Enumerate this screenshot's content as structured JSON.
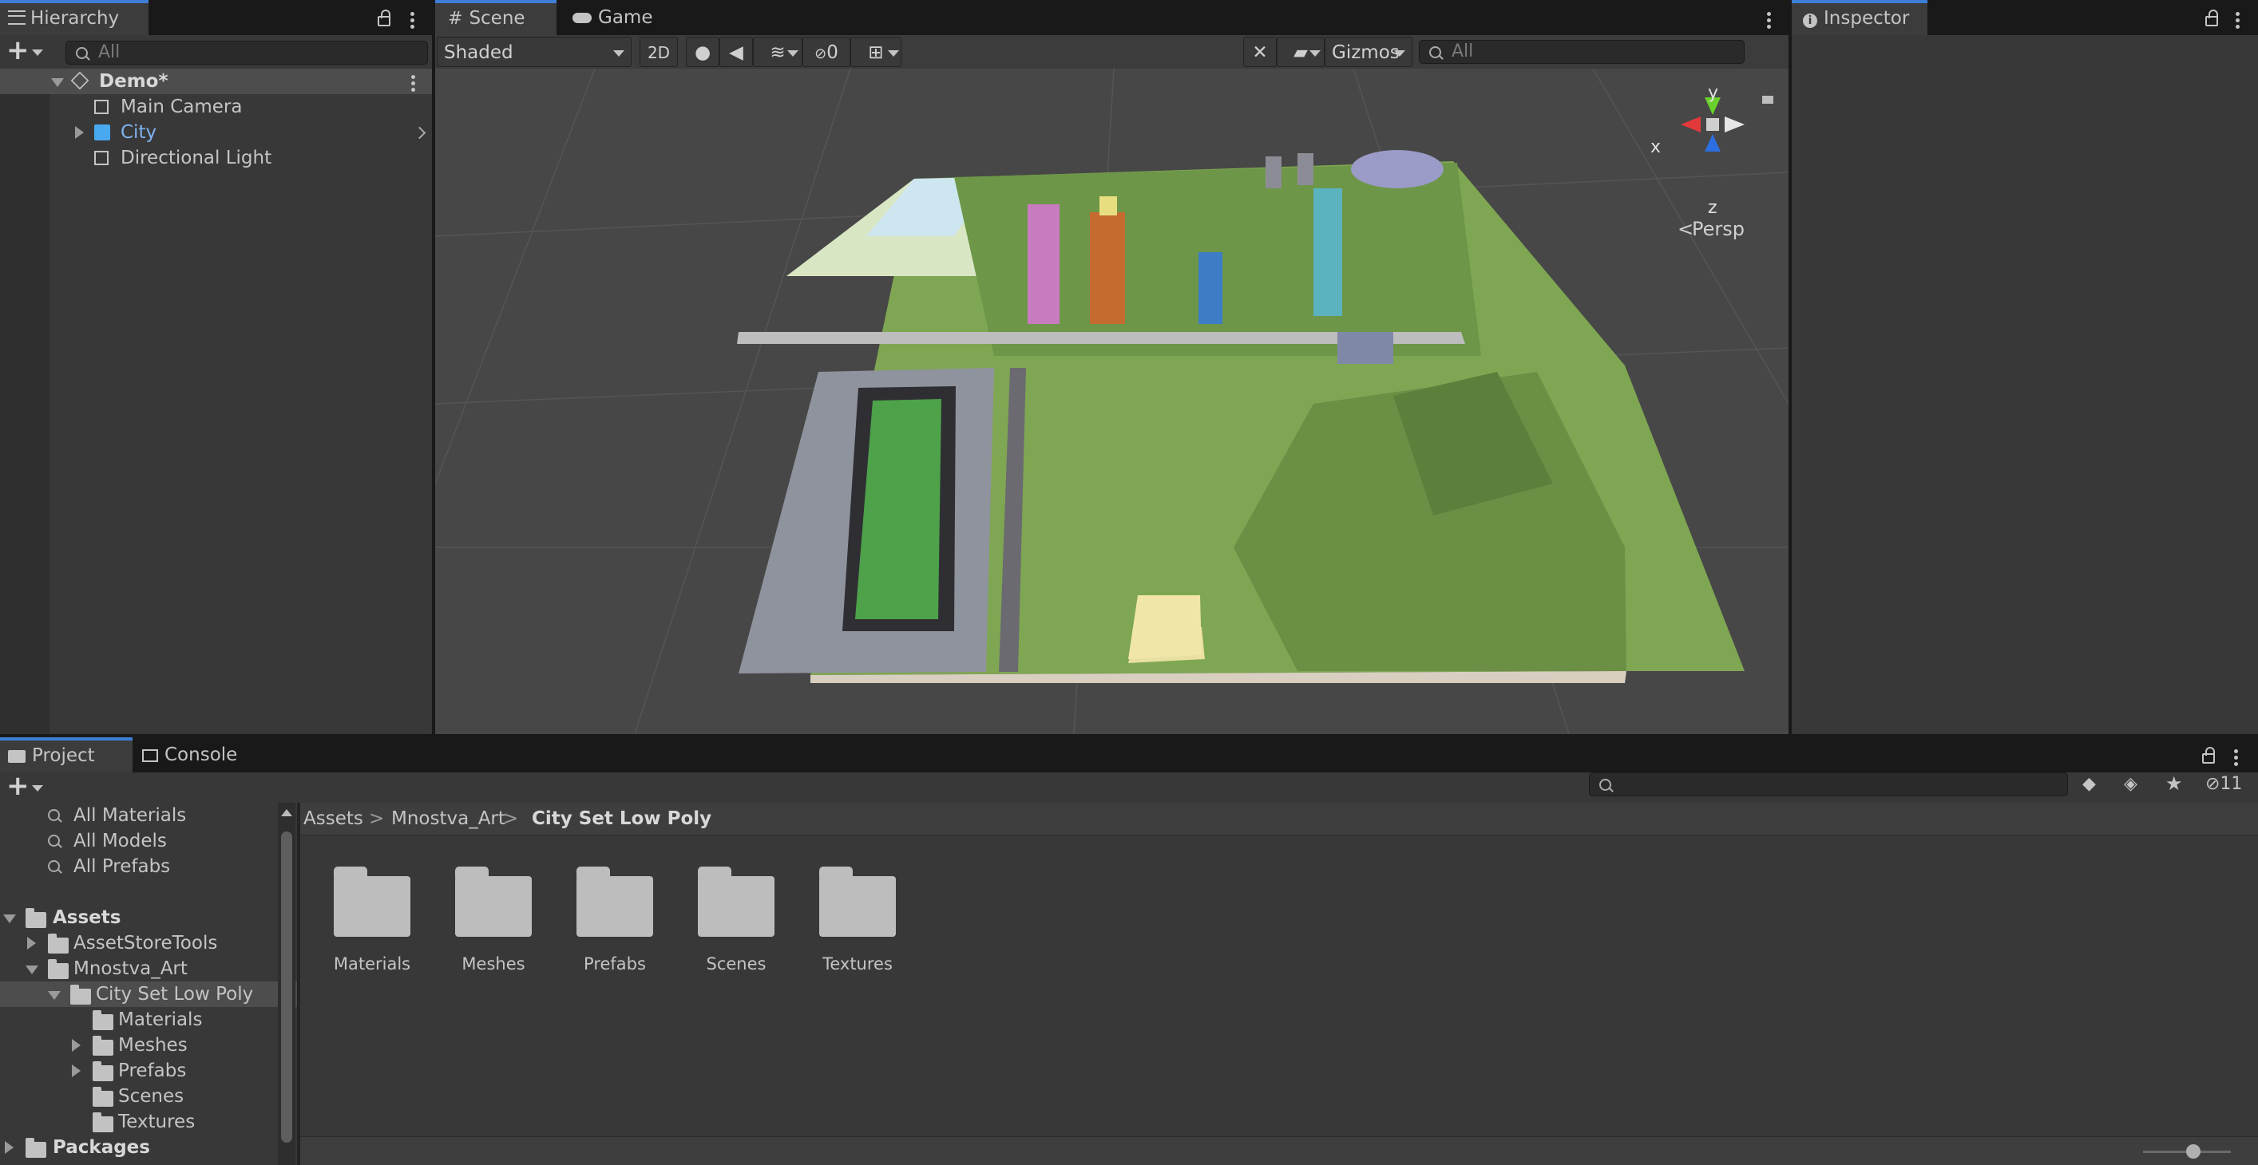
{
  "hierarchy": {
    "tab_label": "Hierarchy",
    "search_placeholder": "All",
    "scene_name": "Demo*",
    "items": [
      {
        "label": "Main Camera"
      },
      {
        "label": "City"
      },
      {
        "label": "Directional Light"
      }
    ]
  },
  "scene_view": {
    "tabs": [
      {
        "label": "Scene"
      },
      {
        "label": "Game"
      }
    ],
    "shading_mode": "Shaded",
    "toggle_2d": "2D",
    "hidden_count": "0",
    "gizmos_label": "Gizmos",
    "search_placeholder": "All",
    "axis_labels": {
      "y": "y",
      "x": "x",
      "z": "z"
    },
    "projection_label": "Persp"
  },
  "inspector": {
    "tab_label": "Inspector"
  },
  "project": {
    "tabs": [
      {
        "label": "Project"
      },
      {
        "label": "Console"
      }
    ],
    "hidden_count": "11",
    "favorites": [
      {
        "label": "All Materials"
      },
      {
        "label": "All Models"
      },
      {
        "label": "All Prefabs"
      }
    ],
    "tree": {
      "assets": "Assets",
      "asset_store_tools": "AssetStoreTools",
      "mnostva_art": "Mnostva_Art",
      "city_set": "City Set Low Poly",
      "materials": "Materials",
      "meshes": "Meshes",
      "prefabs": "Prefabs",
      "scenes": "Scenes",
      "textures": "Textures",
      "packages": "Packages"
    },
    "breadcrumb": [
      "Assets",
      "Mnostva_Art",
      "City Set Low Poly"
    ],
    "folders": [
      {
        "label": "Materials"
      },
      {
        "label": "Meshes"
      },
      {
        "label": "Prefabs"
      },
      {
        "label": "Scenes"
      },
      {
        "label": "Textures"
      }
    ]
  },
  "colors": {
    "accent": "#3d7fd8",
    "selected_row": "#4d4d4d",
    "city_blue": "#7fb2f0"
  }
}
